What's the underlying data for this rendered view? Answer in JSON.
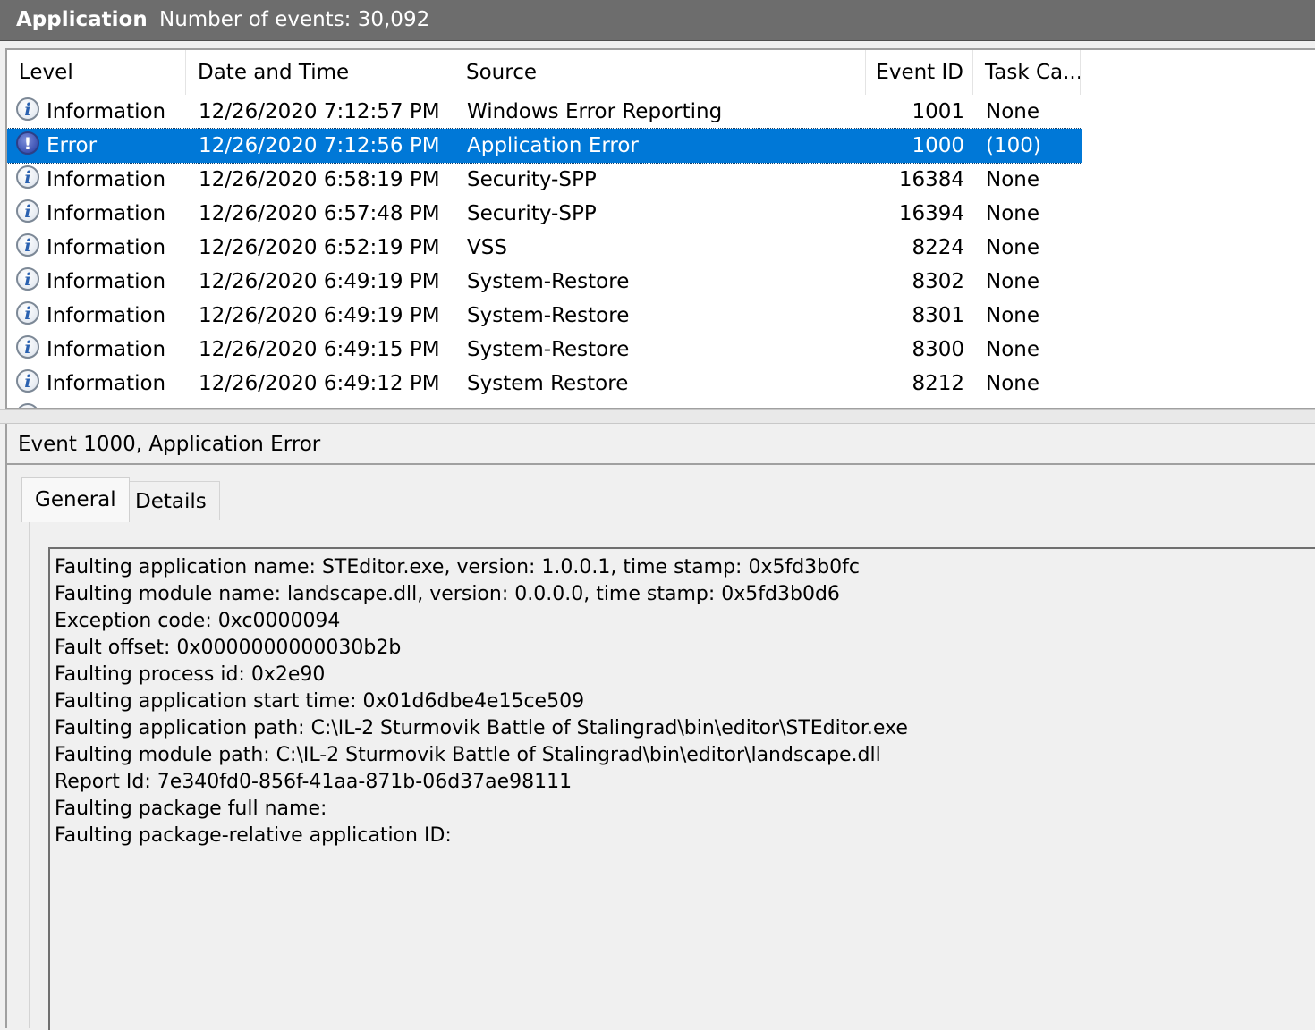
{
  "title_bar": {
    "log_name": "Application",
    "event_count": "Number of events: 30,092"
  },
  "event_list": {
    "columns": [
      {
        "id": "level",
        "label": "Level"
      },
      {
        "id": "datetime",
        "label": "Date and Time"
      },
      {
        "id": "source",
        "label": "Source"
      },
      {
        "id": "event_id",
        "label": "Event ID"
      },
      {
        "id": "task",
        "label": "Task Ca..."
      }
    ],
    "rows": [
      {
        "icon": "information-icon",
        "level": "Information",
        "datetime": "12/26/2020 7:12:57 PM",
        "source": "Windows Error Reporting",
        "event_id": "1001",
        "task": "None",
        "selected": false
      },
      {
        "icon": "error-icon",
        "level": "Error",
        "datetime": "12/26/2020 7:12:56 PM",
        "source": "Application Error",
        "event_id": "1000",
        "task": "(100)",
        "selected": true
      },
      {
        "icon": "information-icon",
        "level": "Information",
        "datetime": "12/26/2020 6:58:19 PM",
        "source": "Security-SPP",
        "event_id": "16384",
        "task": "None",
        "selected": false
      },
      {
        "icon": "information-icon",
        "level": "Information",
        "datetime": "12/26/2020 6:57:48 PM",
        "source": "Security-SPP",
        "event_id": "16394",
        "task": "None",
        "selected": false
      },
      {
        "icon": "information-icon",
        "level": "Information",
        "datetime": "12/26/2020 6:52:19 PM",
        "source": "VSS",
        "event_id": "8224",
        "task": "None",
        "selected": false
      },
      {
        "icon": "information-icon",
        "level": "Information",
        "datetime": "12/26/2020 6:49:19 PM",
        "source": "System-Restore",
        "event_id": "8302",
        "task": "None",
        "selected": false
      },
      {
        "icon": "information-icon",
        "level": "Information",
        "datetime": "12/26/2020 6:49:19 PM",
        "source": "System-Restore",
        "event_id": "8301",
        "task": "None",
        "selected": false
      },
      {
        "icon": "information-icon",
        "level": "Information",
        "datetime": "12/26/2020 6:49:15 PM",
        "source": "System-Restore",
        "event_id": "8300",
        "task": "None",
        "selected": false
      },
      {
        "icon": "information-icon",
        "level": "Information",
        "datetime": "12/26/2020 6:49:12 PM",
        "source": "System Restore",
        "event_id": "8212",
        "task": "None",
        "selected": false
      }
    ]
  },
  "details": {
    "title": "Event 1000, Application Error",
    "tabs": [
      {
        "label": "General",
        "active": true
      },
      {
        "label": "Details",
        "active": false
      }
    ],
    "general_lines": [
      "Faulting application name: STEditor.exe, version: 1.0.0.1, time stamp: 0x5fd3b0fc",
      "Faulting module name: landscape.dll, version: 0.0.0.0, time stamp: 0x5fd3b0d6",
      "Exception code: 0xc0000094",
      "Fault offset: 0x0000000000030b2b",
      "Faulting process id: 0x2e90",
      "Faulting application start time: 0x01d6dbe4e15ce509",
      "Faulting application path: C:\\IL-2 Sturmovik Battle of Stalingrad\\bin\\editor\\STEditor.exe",
      "Faulting module path: C:\\IL-2 Sturmovik Battle of Stalingrad\\bin\\editor\\landscape.dll",
      "Report Id: 7e340fd0-856f-41aa-871b-06d37ae98111",
      "Faulting package full name:",
      "Faulting package-relative application ID:"
    ]
  },
  "colors": {
    "titlebar": "#6d6d6d",
    "selection": "#0078d7",
    "window_bg": "#f0f0f0"
  }
}
